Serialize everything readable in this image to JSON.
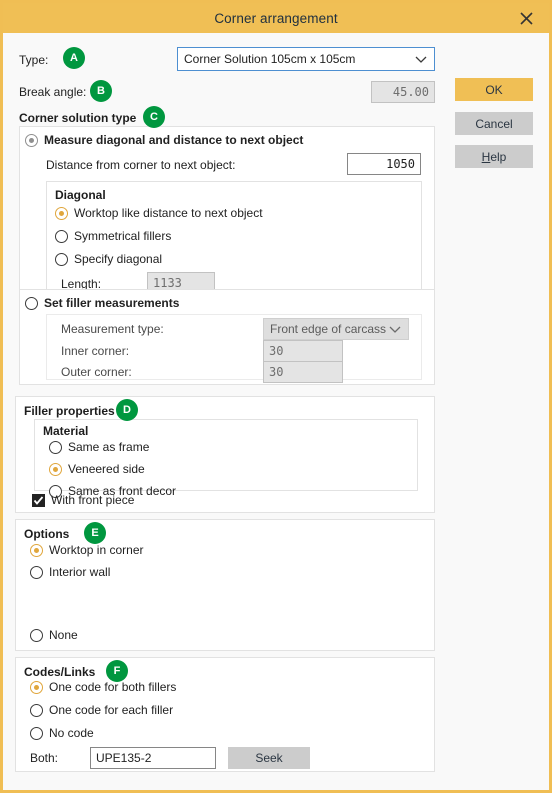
{
  "window": {
    "title": "Corner arrangement",
    "close_icon": "close-icon"
  },
  "buttons": {
    "ok": "OK",
    "cancel": "Cancel",
    "help_underlined": "H",
    "help_rest": "elp"
  },
  "type_row": {
    "label": "Type:",
    "badge": "A",
    "value": "Corner Solution 105cm x 105cm",
    "chevron_icon": "chevron-down-icon"
  },
  "break_angle_row": {
    "label": "Break angle:",
    "badge": "B",
    "value": "45.00"
  },
  "corner_solution_type": {
    "title": "Corner solution type",
    "badge": "C",
    "measure_option": {
      "label": "Measure diagonal and distance to next object",
      "selected": true,
      "distance_label": "Distance from corner to next object:",
      "distance_value": "1050"
    },
    "diagonal": {
      "title": "Diagonal",
      "options": [
        {
          "label": "Worktop like distance to next object",
          "selected": true
        },
        {
          "label": "Symmetrical fillers",
          "selected": false
        },
        {
          "label": "Specify diagonal",
          "selected": false
        }
      ],
      "length_label": "Length:",
      "length_value": "1133"
    },
    "set_filler_option": {
      "label": "Set filler measurements",
      "selected": false,
      "measurement_type_label": "Measurement type:",
      "measurement_type_value": "Front edge of carcass",
      "chevron_icon": "chevron-down-icon",
      "inner_corner_label": "Inner corner:",
      "inner_corner_value": "30",
      "outer_corner_label": "Outer corner:",
      "outer_corner_value": "30"
    }
  },
  "filler_properties": {
    "title": "Filler properties",
    "badge": "D",
    "material_title": "Material",
    "material_options": [
      {
        "label": "Same as frame",
        "selected": false
      },
      {
        "label": "Veneered side",
        "selected": true
      },
      {
        "label": "Same as front decor",
        "selected": false
      }
    ],
    "with_front_piece": {
      "label": "With front piece",
      "checked": true,
      "icon": "checkmark-icon"
    }
  },
  "options": {
    "title": "Options",
    "badge": "E",
    "items": [
      {
        "label": "Worktop in corner",
        "selected": true
      },
      {
        "label": "Interior wall",
        "selected": false
      },
      {
        "label": "None",
        "selected": false
      }
    ]
  },
  "codes_links": {
    "title": "Codes/Links",
    "badge": "F",
    "items": [
      {
        "label": "One code for both fillers",
        "selected": true
      },
      {
        "label": "One code for each filler",
        "selected": false
      },
      {
        "label": "No code",
        "selected": false
      }
    ],
    "both_label": "Both:",
    "both_value": "UPE135-2",
    "seek_label": "Seek"
  },
  "colors": {
    "title_bar": "#f0bf55",
    "accent": "#f0bf55",
    "badge_green": "#00973f",
    "radio_selected": "#e0a63c",
    "button_gray": "#cccccc",
    "focus_border": "#4d8fd1"
  }
}
